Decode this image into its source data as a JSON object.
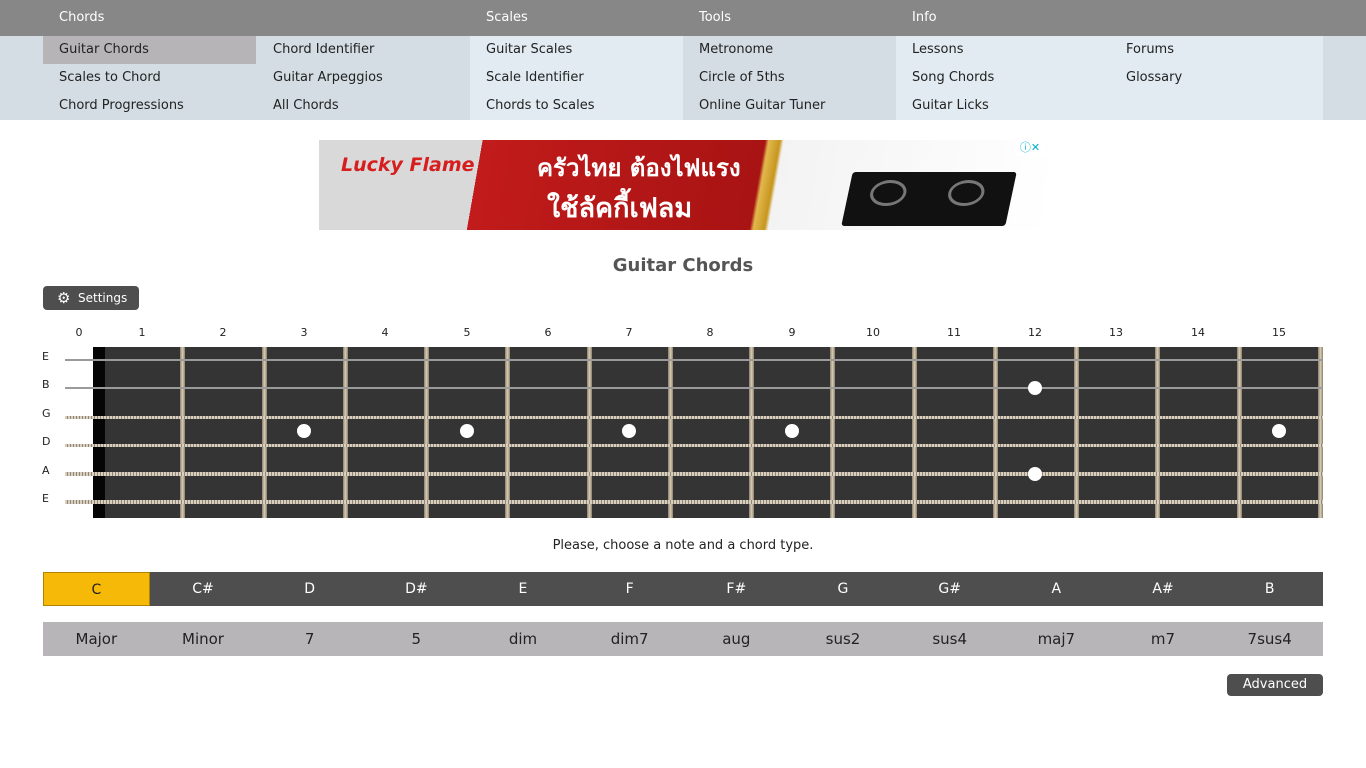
{
  "nav": {
    "categories": [
      "Chords",
      "Scales",
      "Tools",
      "Info"
    ],
    "chords_col1": [
      "Guitar Chords",
      "Scales to Chord",
      "Chord Progressions"
    ],
    "chords_col2": [
      "Chord Identifier",
      "Guitar Arpeggios",
      "All Chords"
    ],
    "scales_col": [
      "Guitar Scales",
      "Scale Identifier",
      "Chords to Scales"
    ],
    "tools_col": [
      "Metronome",
      "Circle of 5ths",
      "Online Guitar Tuner"
    ],
    "info_col1": [
      "Lessons",
      "Song Chords",
      "Guitar Licks"
    ],
    "info_col2": [
      "Forums",
      "Glossary"
    ],
    "active_item": "Guitar Chords",
    "active_color": "#b7b4b8"
  },
  "ad": {
    "brand": "Lucky Flame",
    "line1": "ครัวไทย ต้องไฟแรง",
    "line2": "ใช้ลัคกี้เฟลม",
    "close_label": "ⓘ✕"
  },
  "page": {
    "title": "Guitar Chords",
    "settings_label": "Settings",
    "instruction": "Please, choose a note and a chord type.",
    "advanced_label": "Advanced"
  },
  "fretboard": {
    "fret_numbers": [
      "0",
      "1",
      "2",
      "3",
      "4",
      "5",
      "6",
      "7",
      "8",
      "9",
      "10",
      "11",
      "12",
      "13",
      "14",
      "15"
    ],
    "strings": [
      "E",
      "B",
      "G",
      "D",
      "A",
      "E"
    ],
    "inlay_frets": [
      3,
      5,
      7,
      9,
      12,
      15
    ]
  },
  "notes": {
    "items": [
      "C",
      "C#",
      "D",
      "D#",
      "E",
      "F",
      "F#",
      "G",
      "G#",
      "A",
      "A#",
      "B"
    ],
    "selected": "C",
    "accent_color": "#f6b908"
  },
  "chord_types": {
    "items": [
      "Major",
      "Minor",
      "7",
      "5",
      "dim",
      "dim7",
      "aug",
      "sus2",
      "sus4",
      "maj7",
      "m7",
      "7sus4"
    ]
  }
}
